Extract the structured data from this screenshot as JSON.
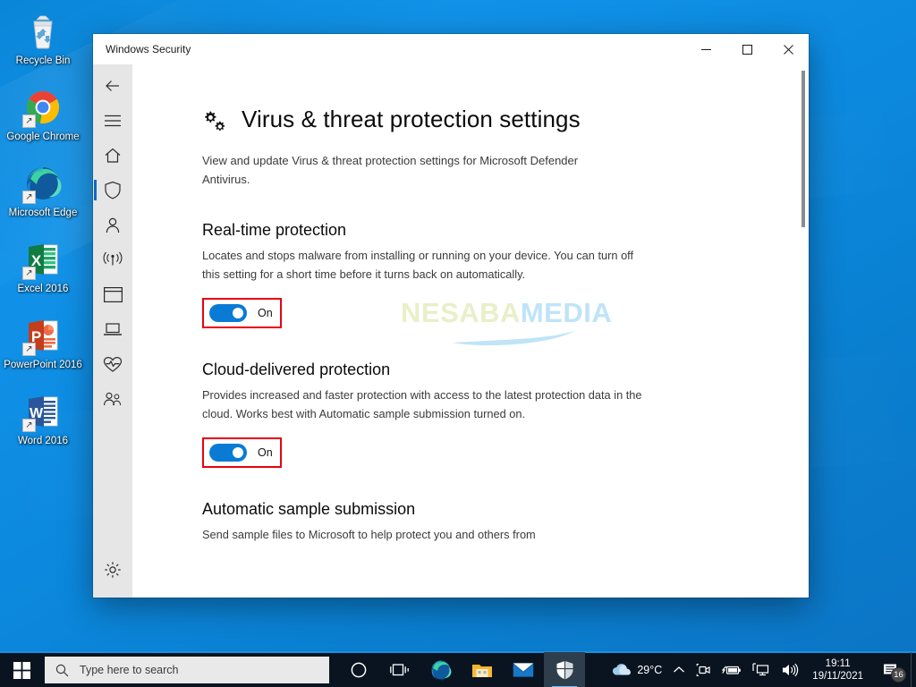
{
  "desktop": {
    "icons": [
      {
        "label": "Recycle Bin",
        "icon": "recycle-bin-icon",
        "shortcut": false
      },
      {
        "label": "Google Chrome",
        "icon": "chrome-icon",
        "shortcut": true
      },
      {
        "label": "Microsoft Edge",
        "icon": "edge-icon",
        "shortcut": true
      },
      {
        "label": "Excel 2016",
        "icon": "excel-icon",
        "shortcut": true
      },
      {
        "label": "PowerPoint 2016",
        "icon": "powerpoint-icon",
        "shortcut": true
      },
      {
        "label": "Word 2016",
        "icon": "word-icon",
        "shortcut": true
      }
    ]
  },
  "window": {
    "title": "Windows Security",
    "controls": {
      "minimize": "minimize-icon",
      "maximize": "maximize-icon",
      "close": "close-icon"
    },
    "sidebar": {
      "items": [
        {
          "name": "back",
          "icon": "back-arrow-icon",
          "selected": false
        },
        {
          "name": "menu",
          "icon": "hamburger-menu-icon",
          "selected": false
        },
        {
          "name": "home",
          "icon": "home-icon",
          "selected": false
        },
        {
          "name": "virus-threat-protection",
          "icon": "shield-icon",
          "selected": true
        },
        {
          "name": "account-protection",
          "icon": "person-icon",
          "selected": false
        },
        {
          "name": "firewall-network-protection",
          "icon": "wifi-icon",
          "selected": false
        },
        {
          "name": "app-browser-control",
          "icon": "app-window-icon",
          "selected": false
        },
        {
          "name": "device-security",
          "icon": "laptop-icon",
          "selected": false
        },
        {
          "name": "device-performance-health",
          "icon": "heart-pulse-icon",
          "selected": false
        },
        {
          "name": "family-options",
          "icon": "family-people-icon",
          "selected": false
        }
      ],
      "footer": {
        "name": "settings",
        "icon": "gear-icon"
      }
    },
    "page": {
      "icon": "gears-settings-icon",
      "title": "Virus & threat protection settings",
      "subtitle": "View and update Virus & threat protection settings for Microsoft Defender Antivirus.",
      "sections": [
        {
          "title": "Real-time protection",
          "description": "Locates and stops malware from installing or running on your device. You can turn off this setting for a short time before it turns back on automatically.",
          "toggle": {
            "state": "On",
            "label": "On",
            "on": true,
            "highlighted": true
          }
        },
        {
          "title": "Cloud-delivered protection",
          "description": "Provides increased and faster protection with access to the latest protection data in the cloud. Works best with Automatic sample submission turned on.",
          "toggle": {
            "state": "On",
            "label": "On",
            "on": true,
            "highlighted": true
          }
        },
        {
          "title": "Automatic sample submission",
          "description": "Send sample files to Microsoft to help protect you and others from",
          "toggle": null
        }
      ]
    }
  },
  "watermark": {
    "part1": "NESABA",
    "part2": "MEDIA"
  },
  "taskbar": {
    "start": "windows-start-icon",
    "search": {
      "placeholder": "Type here to search",
      "value": "",
      "icon": "search-icon"
    },
    "items": [
      {
        "name": "cortana",
        "icon": "cortana-circle-icon",
        "active": false
      },
      {
        "name": "task-view",
        "icon": "task-view-icon",
        "active": false
      },
      {
        "name": "microsoft-edge",
        "icon": "edge-icon",
        "active": false
      },
      {
        "name": "file-explorer",
        "icon": "folder-icon",
        "active": false
      },
      {
        "name": "mail",
        "icon": "mail-envelope-icon",
        "active": false
      },
      {
        "name": "windows-security",
        "icon": "shield-solid-icon",
        "active": true
      }
    ],
    "tray": {
      "weather": {
        "icon": "cloud-icon",
        "temperature": "29°C"
      },
      "chevron": "chevron-up-icon",
      "icons": [
        {
          "name": "camera-privacy",
          "icon": "camera-icon"
        },
        {
          "name": "battery",
          "icon": "battery-charging-icon"
        },
        {
          "name": "network",
          "icon": "network-monitor-icon"
        },
        {
          "name": "volume",
          "icon": "speaker-icon"
        }
      ],
      "clock": {
        "time": "19:11",
        "date": "19/11/2021"
      },
      "notifications": {
        "icon": "notification-icon",
        "count": "16"
      }
    }
  },
  "colors": {
    "accent_blue": "#0a7bd4",
    "highlight_red": "#e8000f",
    "sidebar_gray": "#e6e6e6",
    "taskbar": "#0a1420",
    "desktop_blue": "#1192e8"
  }
}
